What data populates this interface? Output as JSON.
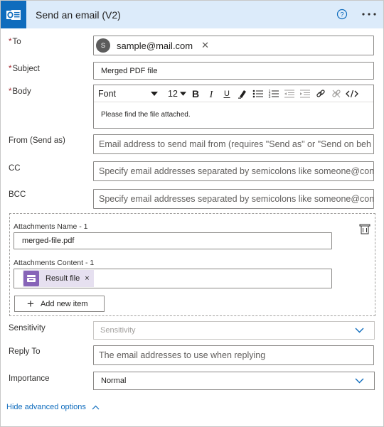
{
  "header": {
    "title": "Send an email (V2)",
    "app_icon": "outlook-icon",
    "help_icon": "help-circle-icon",
    "more_icon": "more-ellipsis-icon",
    "bg_color": "#dcebfa",
    "accent_color": "#0f6cbd"
  },
  "fields": {
    "to": {
      "label": "To",
      "required_mark": "*",
      "token": {
        "avatar_initial": "S",
        "text": "sample@mail.com",
        "remove": "✕"
      }
    },
    "subject": {
      "label": "Subject",
      "required_mark": "*",
      "value": "Merged PDF file"
    },
    "body": {
      "label": "Body",
      "required_mark": "*",
      "font": "Font",
      "font_size": "12",
      "toolbar_buttons": [
        "bold",
        "italic",
        "underline",
        "highlighter",
        "bulleted-list",
        "numbered-list",
        "decrease-indent",
        "increase-indent",
        "link",
        "unlink",
        "code-view"
      ],
      "content": "Please find the file attached."
    },
    "from": {
      "label": "From (Send as)",
      "placeholder": "Email address to send mail from (requires \"Send as\" or \"Send on beh"
    },
    "cc": {
      "label": "CC",
      "placeholder": "Specify email addresses separated by semicolons like someone@con"
    },
    "bcc": {
      "label": "BCC",
      "placeholder": "Specify email addresses separated by semicolons like someone@con"
    },
    "attachments": {
      "name_label": "Attachments Name - 1",
      "name_value": "merged-file.pdf",
      "content_label": "Attachments Content - 1",
      "content_token": "Result file",
      "content_token_remove": "×",
      "add_button": "Add new item",
      "delete_icon": "delete-item-icon"
    },
    "sensitivity": {
      "label": "Sensitivity",
      "placeholder": "Sensitivity"
    },
    "reply_to": {
      "label": "Reply To",
      "placeholder": "The email addresses to use when replying"
    },
    "importance": {
      "label": "Importance",
      "value": "Normal"
    }
  },
  "footer": {
    "link": "Hide advanced options"
  }
}
